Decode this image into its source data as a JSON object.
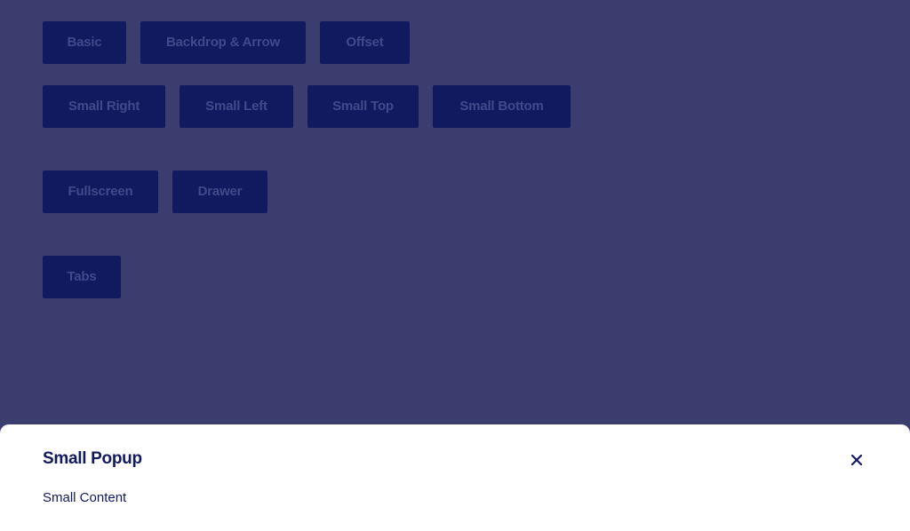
{
  "buttons": {
    "basic": "Basic",
    "backdrop_arrow": "Backdrop & Arrow",
    "offset": "Offset",
    "small_right": "Small Right",
    "small_left": "Small Left",
    "small_top": "Small Top",
    "small_bottom": "Small Bottom",
    "fullscreen": "Fullscreen",
    "drawer": "Drawer",
    "tabs": "Tabs"
  },
  "popup": {
    "title": "Small Popup",
    "content": "Small Content",
    "close_icon": "close-icon"
  },
  "colors": {
    "backdrop": "#3a3d6e",
    "button_bg": "#111a5e",
    "button_text": "#3e4a8a",
    "popup_bg": "#ffffff",
    "popup_text": "#111a5e"
  }
}
